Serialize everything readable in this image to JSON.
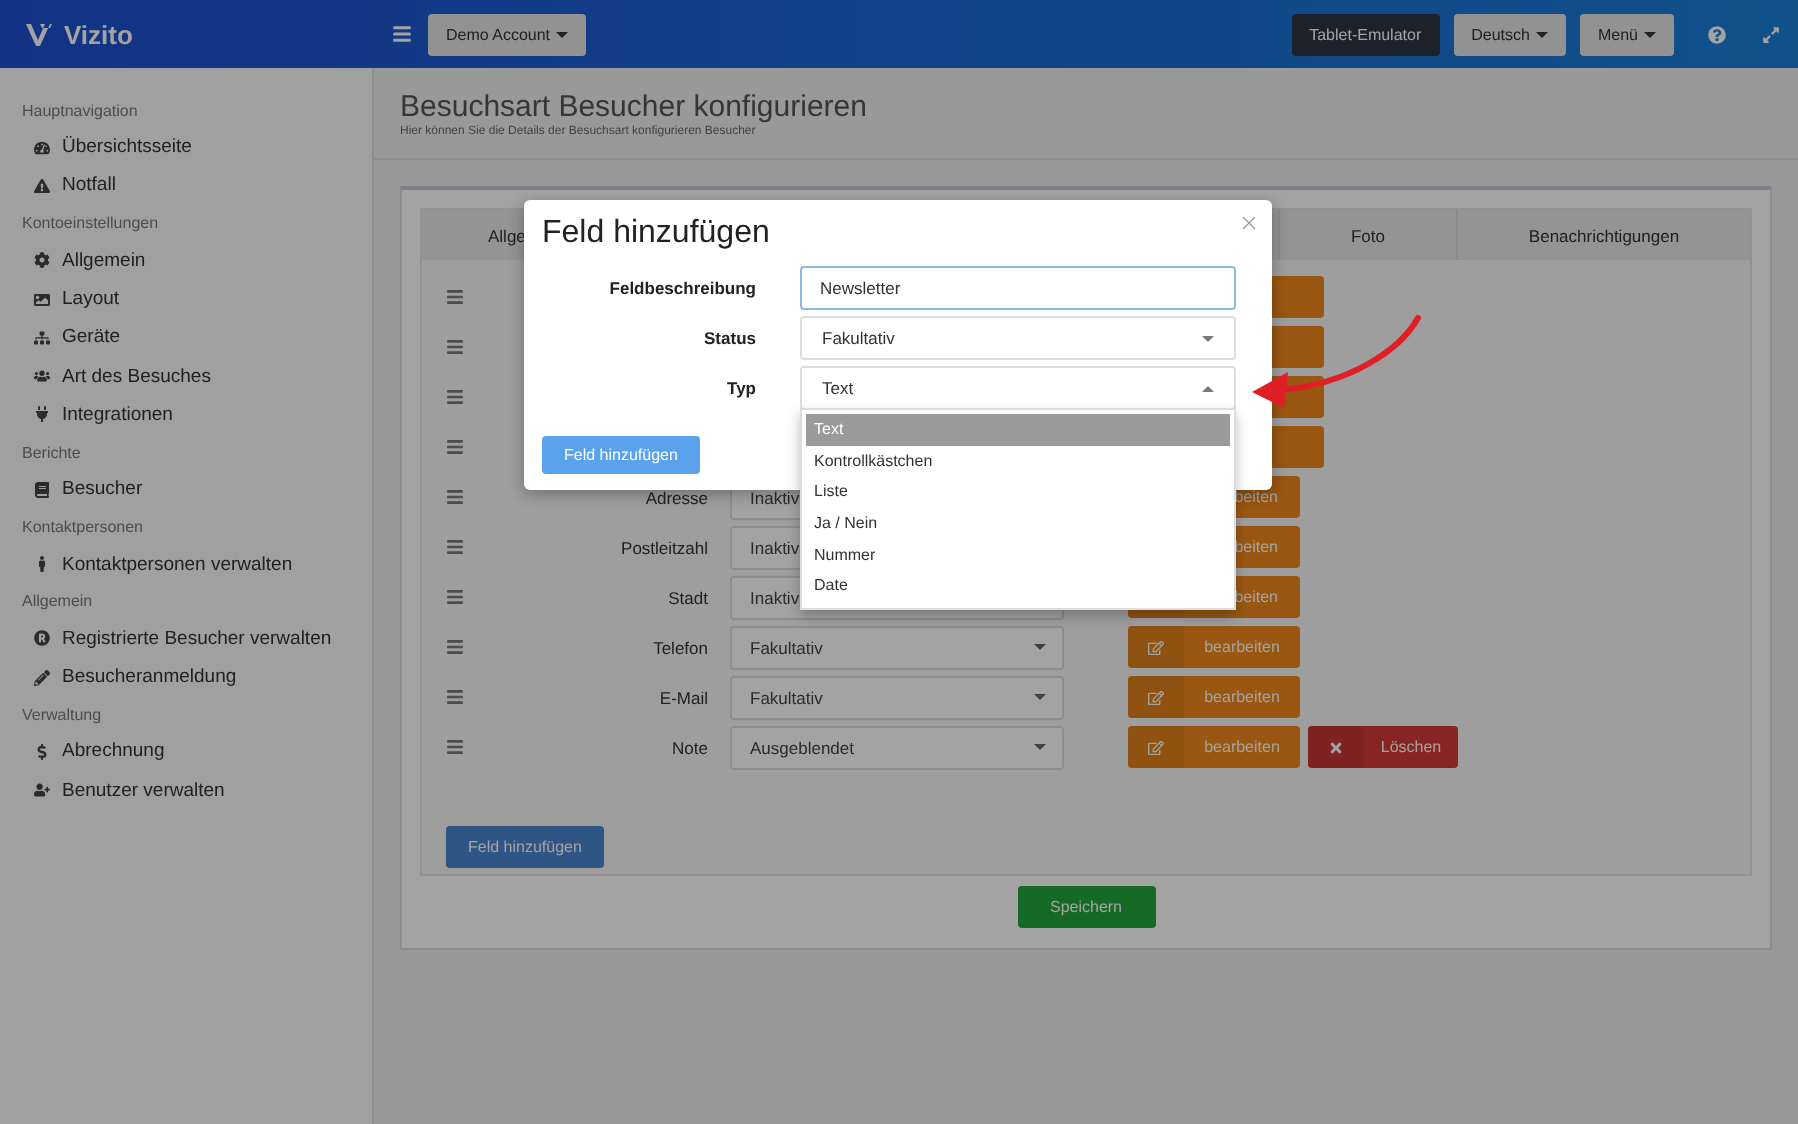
{
  "topbar": {
    "logo": "Vizito",
    "account": "Demo Account",
    "buttons": [
      {
        "label": "Tablet-Emulator",
        "kind": "dark"
      },
      {
        "label": "Deutsch",
        "kind": "dropdown"
      },
      {
        "label": "Menü",
        "kind": "dropdown"
      }
    ]
  },
  "sidebar": {
    "groups": [
      {
        "title": "Hauptnavigation",
        "items": [
          "Übersichtsseite",
          "Notfall"
        ]
      },
      {
        "title": "Kontoeinstellungen",
        "items": [
          "Allgemein",
          "Layout",
          "Geräte",
          "Art des Besuches",
          "Integrationen"
        ]
      },
      {
        "title": "Berichte",
        "items": [
          "Besucher"
        ]
      },
      {
        "title": "Kontaktpersonen",
        "items": [
          "Kontaktpersonen verwalten"
        ]
      },
      {
        "title": "Allgemein",
        "items": [
          "Registrierte Besucher verwalten",
          "Besucheranmeldung"
        ]
      },
      {
        "title": "Verwaltung",
        "items": [
          "Abrechnung",
          "Benutzer verwalten"
        ]
      }
    ]
  },
  "page": {
    "title": "Besuchsart Besucher konfigurieren",
    "subtitle": "Hier können Sie die Details der Besuchsart konfigurieren Besucher"
  },
  "table": {
    "columns": [
      "Allge",
      "Foto",
      "Benachrichtigungen"
    ],
    "rows": [
      {},
      {},
      {},
      {},
      {
        "label": "Adresse",
        "status": "Inaktiv",
        "edit": "beiten"
      },
      {
        "label": "Postleitzahl",
        "status": "Inaktiv",
        "edit": "beiten"
      },
      {
        "label": "Stadt",
        "status": "Inaktiv",
        "edit": "beiten"
      },
      {
        "label": "Telefon",
        "status": "Fakultativ",
        "edit": "bearbeiten"
      },
      {
        "label": "E-Mail",
        "status": "Fakultativ",
        "edit": "bearbeiten"
      },
      {
        "label": "Note",
        "status": "Ausgeblendet",
        "edit": "bearbeiten",
        "delete": "Löschen"
      }
    ]
  },
  "add_button": "Feld hinzufügen",
  "save_button": "Speichern",
  "dialog": {
    "title": "Feld hinzufügen",
    "fields": [
      {
        "label": "Feldbeschreibung",
        "kind": "input",
        "value": "Newsletter"
      },
      {
        "label": "Status",
        "kind": "select",
        "value": "Fakultativ",
        "expanded": false
      },
      {
        "label": "Typ",
        "kind": "select",
        "value": "Text",
        "expanded": true,
        "options": [
          {
            "label": "Text",
            "selected": true
          },
          {
            "label": "Kontrollkästchen",
            "selected": false
          },
          {
            "label": "Liste",
            "selected": false
          },
          {
            "label": "Ja / Nein",
            "selected": false
          },
          {
            "label": "Nummer",
            "selected": false
          },
          {
            "label": "Date",
            "selected": false
          }
        ]
      }
    ],
    "button": "Feld hinzufügen"
  }
}
